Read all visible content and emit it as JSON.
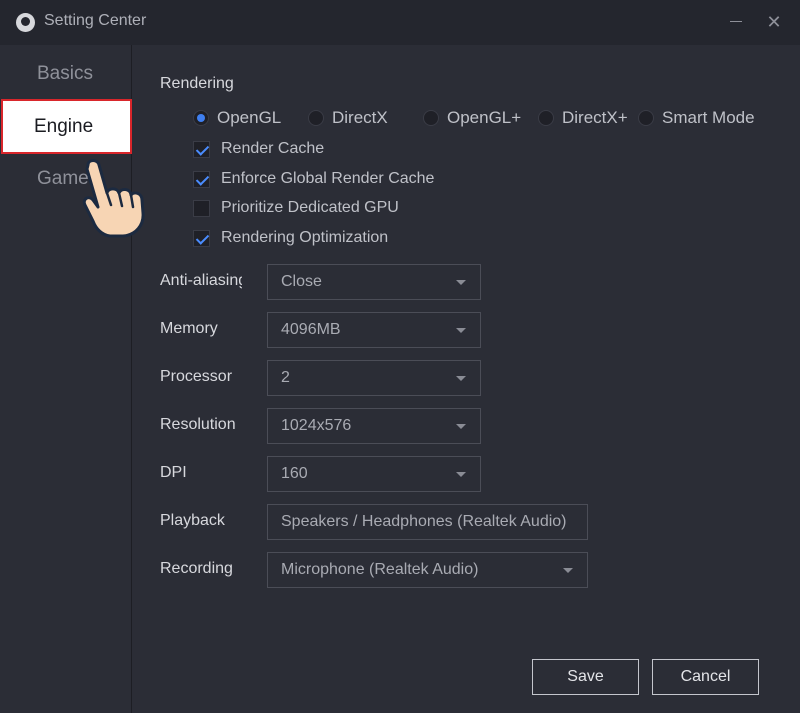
{
  "window": {
    "title": "Setting Center",
    "minimize_icon": "minimize-icon",
    "close_symbol": "✕"
  },
  "sidebar": {
    "items": [
      {
        "label": "Basics"
      },
      {
        "label": "Engine",
        "selected": true
      },
      {
        "label": "Game"
      }
    ]
  },
  "rendering": {
    "title": "Rendering",
    "modes": [
      {
        "label": "OpenGL",
        "selected": true
      },
      {
        "label": "DirectX",
        "selected": false
      },
      {
        "label": "OpenGL+",
        "selected": false
      },
      {
        "label": "DirectX+",
        "selected": false
      },
      {
        "label": "Smart Mode",
        "selected": false
      }
    ],
    "options": [
      {
        "label": "Render Cache",
        "checked": true
      },
      {
        "label": "Enforce Global Render Cache",
        "checked": true
      },
      {
        "label": "Prioritize Dedicated GPU",
        "checked": false
      },
      {
        "label": "Rendering Optimization",
        "checked": true
      }
    ]
  },
  "fields": {
    "anti_aliasing": {
      "label": "Anti-aliasing",
      "value": "Close"
    },
    "memory": {
      "label": "Memory",
      "value": "4096MB"
    },
    "processor": {
      "label": "Processor",
      "value": "2"
    },
    "resolution": {
      "label": "Resolution",
      "value": "1024x576"
    },
    "dpi": {
      "label": "DPI",
      "value": "160"
    },
    "playback": {
      "label": "Playback",
      "value": "Speakers / Headphones (Realtek Audio)"
    },
    "recording": {
      "label": "Recording",
      "value": "Microphone (Realtek Audio)"
    }
  },
  "buttons": {
    "save": "Save",
    "cancel": "Cancel"
  },
  "colors": {
    "accent": "#3f7ff0",
    "highlight_border": "#d9262b",
    "background": "#2b2d36"
  },
  "overlay": {
    "icon": "pointing-hand-icon"
  }
}
